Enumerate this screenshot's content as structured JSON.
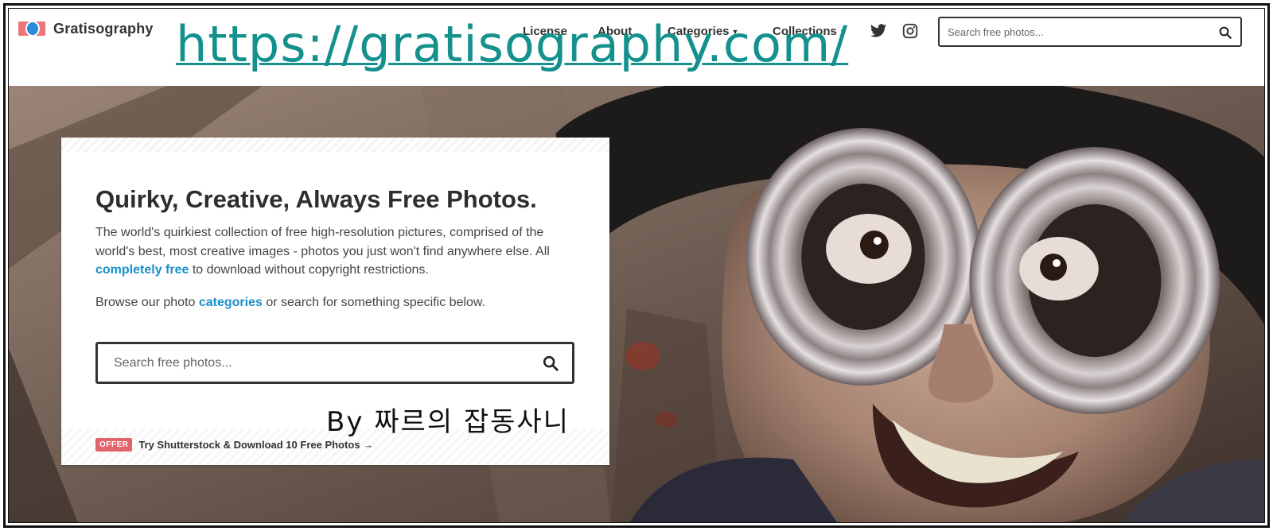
{
  "overlay": {
    "url_text": "https://gratisography.com/",
    "credit_text": "By 짜르의 잡동사니"
  },
  "header": {
    "logo_text": "Gratisography",
    "nav": [
      {
        "label": "License",
        "has_caret": false
      },
      {
        "label": "About",
        "has_caret": false
      },
      {
        "label": "Categories",
        "has_caret": true
      },
      {
        "label": "Collections",
        "has_caret": true
      }
    ],
    "social_icons": [
      "twitter-icon",
      "instagram-icon"
    ],
    "search_placeholder": "Search free photos..."
  },
  "hero": {
    "title": "Quirky, Creative, Always Free Photos.",
    "desc_before_link": "The world's quirkiest collection of free high-resolution pictures, comprised of the world's best, most creative images - photos you just won't find anywhere else. All ",
    "desc_link": "completely free",
    "desc_after_link": " to download without copyright restrictions.",
    "browse_before_link": "Browse our photo ",
    "browse_link": "categories",
    "browse_after_link": " or search for something specific below.",
    "search_placeholder": "Search free photos...",
    "offer_badge": "OFFER",
    "offer_text": "Try Shutterstock & Download 10 Free Photos →"
  },
  "colors": {
    "link": "#1b8fc9",
    "offer_badge": "#e3636c",
    "overlay_url": "#14918c",
    "logo_red": "#e8767a",
    "logo_blue": "#2b8bdb"
  }
}
